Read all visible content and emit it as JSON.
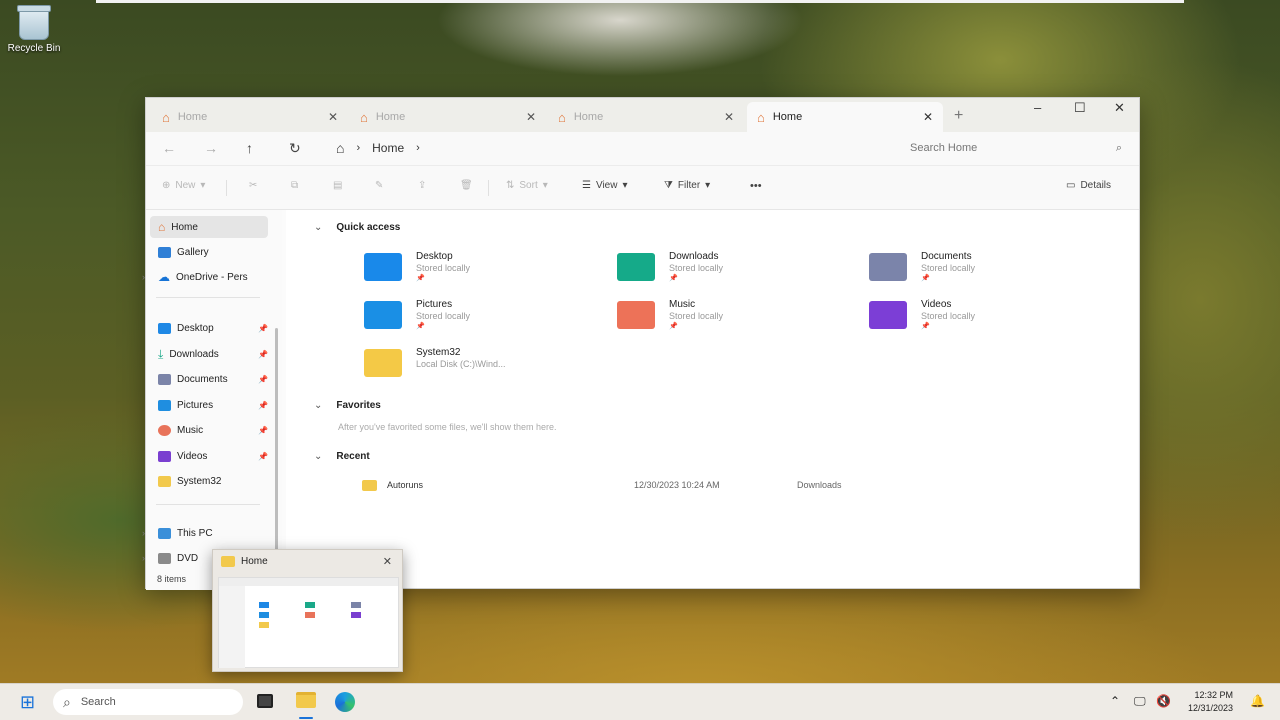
{
  "desktop": {
    "recycle_bin_label": "Recycle Bin"
  },
  "window": {
    "tabs": [
      {
        "label": "Home"
      },
      {
        "label": "Home"
      },
      {
        "label": "Home"
      },
      {
        "label": "Home"
      }
    ],
    "new_tab_label": "+",
    "controls": {
      "minimize": "–",
      "maximize": "☐",
      "close": "✕"
    },
    "address": {
      "crumb": "Home"
    },
    "search_placeholder": "Search Home",
    "commands": {
      "new": "New",
      "sort": "Sort",
      "view": "View",
      "filter": "Filter",
      "more": "•••",
      "details": "Details"
    },
    "sidebar": {
      "home": "Home",
      "gallery": "Gallery",
      "onedrive": "OneDrive - Pers",
      "pinned": [
        {
          "label": "Desktop"
        },
        {
          "label": "Downloads"
        },
        {
          "label": "Documents"
        },
        {
          "label": "Pictures"
        },
        {
          "label": "Music"
        },
        {
          "label": "Videos"
        },
        {
          "label": "System32"
        }
      ],
      "this_pc": "This PC",
      "dvd": "DVD"
    },
    "status": "8 items",
    "quick_access": {
      "title": "Quick access",
      "items": [
        {
          "name": "Desktop",
          "sub": "Stored locally",
          "color": "#1e88e5"
        },
        {
          "name": "Downloads",
          "sub": "Stored locally",
          "color": "#1aa889"
        },
        {
          "name": "Documents",
          "sub": "Stored locally",
          "color": "#7b84a8"
        },
        {
          "name": "Pictures",
          "sub": "Stored locally",
          "color": "#1f8ee0"
        },
        {
          "name": "Music",
          "sub": "Stored locally",
          "color": "#e8735a"
        },
        {
          "name": "Videos",
          "sub": "Stored locally",
          "color": "#7a3fd0"
        },
        {
          "name": "System32",
          "sub": "Local Disk (C:)\\Wind...",
          "color": "#f2c94c"
        }
      ]
    },
    "favorites": {
      "title": "Favorites",
      "empty_text": "After you've favorited some files, we'll show them here."
    },
    "recent": {
      "title": "Recent",
      "items": [
        {
          "name": "Autoruns",
          "date": "12/30/2023 10:24 AM",
          "location": "Downloads"
        }
      ]
    }
  },
  "thumbnail": {
    "title": "Home",
    "close": "✕"
  },
  "taskbar": {
    "search_placeholder": "Search",
    "time": "12:32 PM",
    "date": "12/31/2023"
  }
}
